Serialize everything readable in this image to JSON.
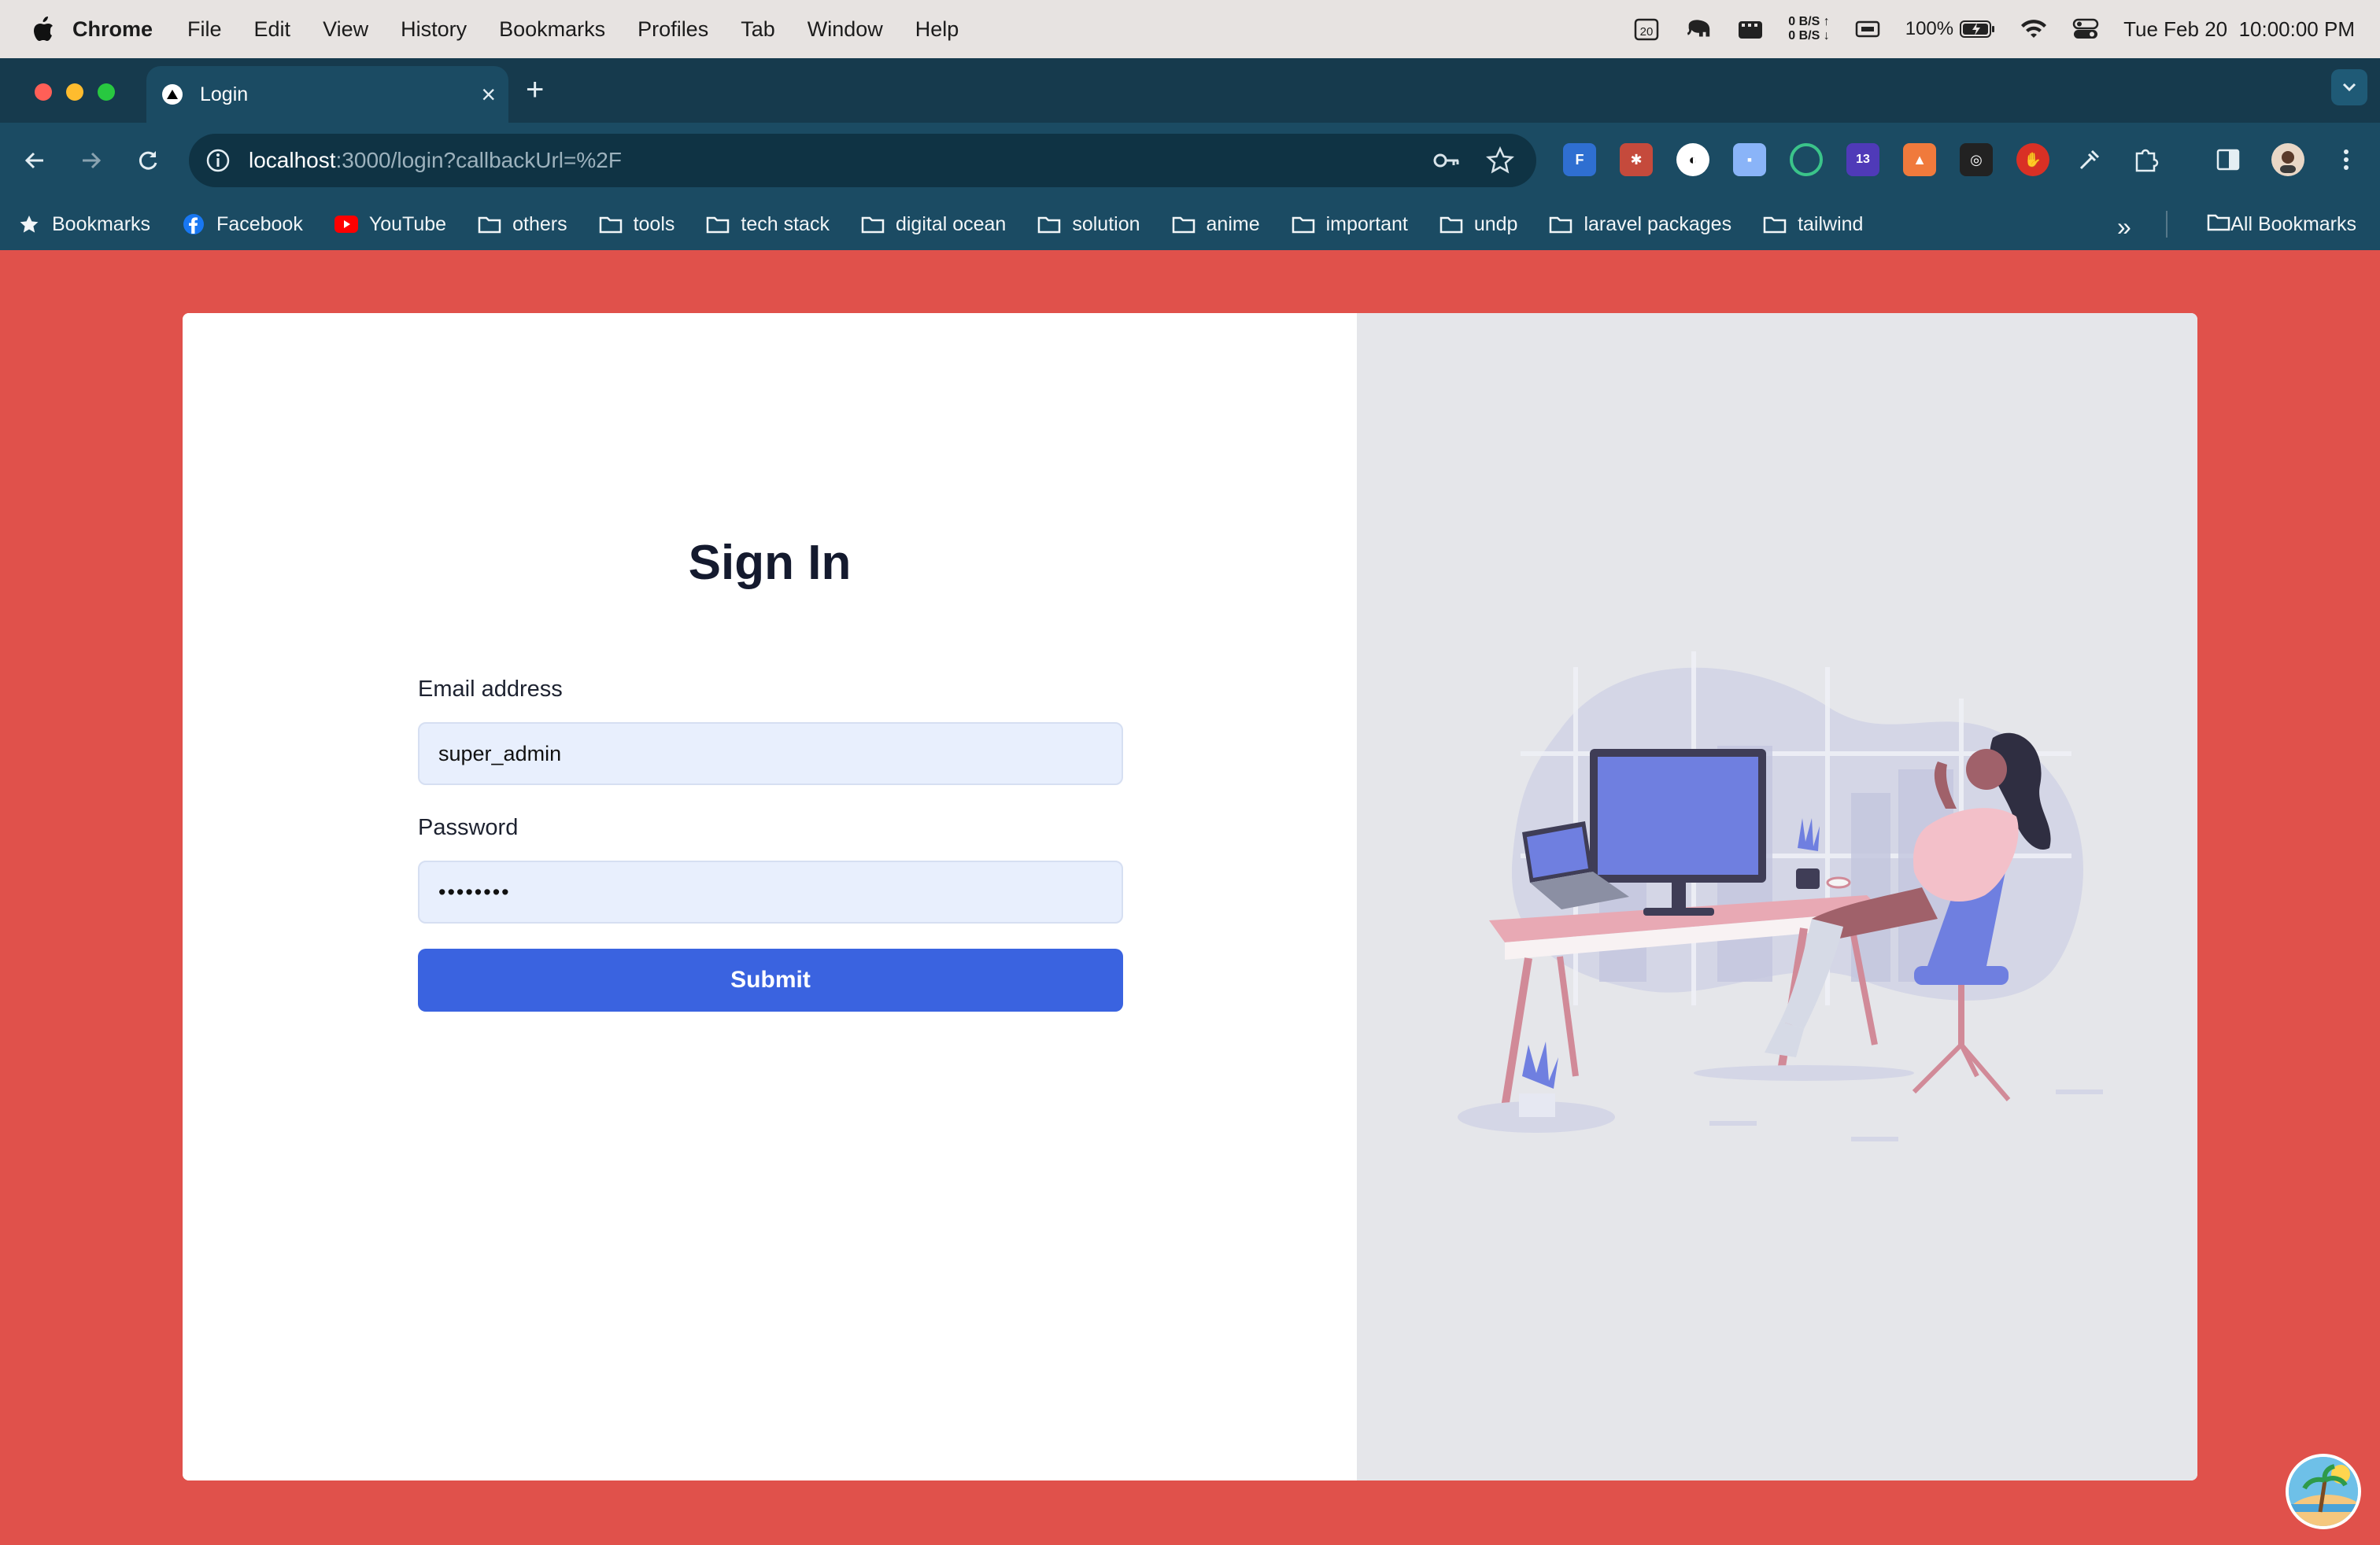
{
  "menubar": {
    "app": "Chrome",
    "items": [
      "File",
      "Edit",
      "View",
      "History",
      "Bookmarks",
      "Profiles",
      "Tab",
      "Window",
      "Help"
    ],
    "calendar_day": "20",
    "net_up": "0 B/S ↑",
    "net_down": "0 B/S ↓",
    "battery": "100%",
    "datetime": "Tue Feb 20  10:00:00 PM"
  },
  "browser": {
    "tab_title": "Login",
    "url_host": "localhost",
    "url_rest": ":3000/login?callbackUrl=%2F",
    "ext_badge": "13"
  },
  "bookmarks": {
    "items": [
      "Bookmarks",
      "Facebook",
      "YouTube",
      "others",
      "tools",
      "tech stack",
      "digital ocean",
      "solution",
      "anime",
      "important",
      "undp",
      "laravel packages",
      "tailwind"
    ],
    "all": "All Bookmarks"
  },
  "login": {
    "title": "Sign In",
    "email_label": "Email address",
    "email_value": "super_admin",
    "password_label": "Password",
    "password_value": "••••••••",
    "submit": "Submit"
  },
  "colors": {
    "page_bg": "#e0514b",
    "button": "#3a63e0",
    "illustration_accent": "#6f7fe0"
  }
}
